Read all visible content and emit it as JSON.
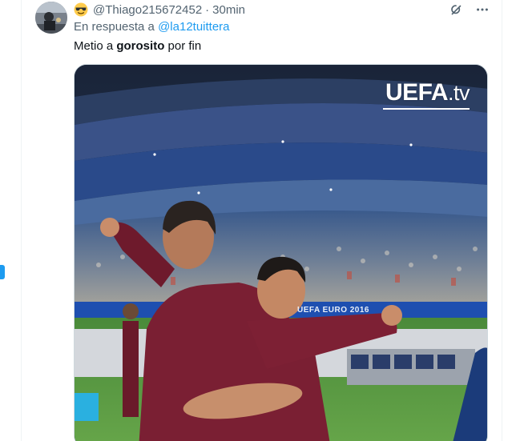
{
  "tweet": {
    "handle": "@Thiago215672452",
    "separator": "·",
    "time": "30min",
    "reply_prefix": "En respuesta a",
    "reply_to": "@la12tuittera",
    "text_before": "Metio a ",
    "text_bold": "gorosito",
    "text_after": " por fin",
    "emoji": "smiling-face-with-sunglasses"
  },
  "media": {
    "watermark_brand": "UEFA",
    "watermark_suffix": ".tv",
    "banner_text": "UEFA EURO 2016"
  },
  "icons": {
    "grok": "grok-icon",
    "more": "more-icon"
  },
  "colors": {
    "accent": "#1d9bf0",
    "text_secondary": "#536471",
    "text_primary": "#0f1419",
    "border": "#cfd9de"
  }
}
